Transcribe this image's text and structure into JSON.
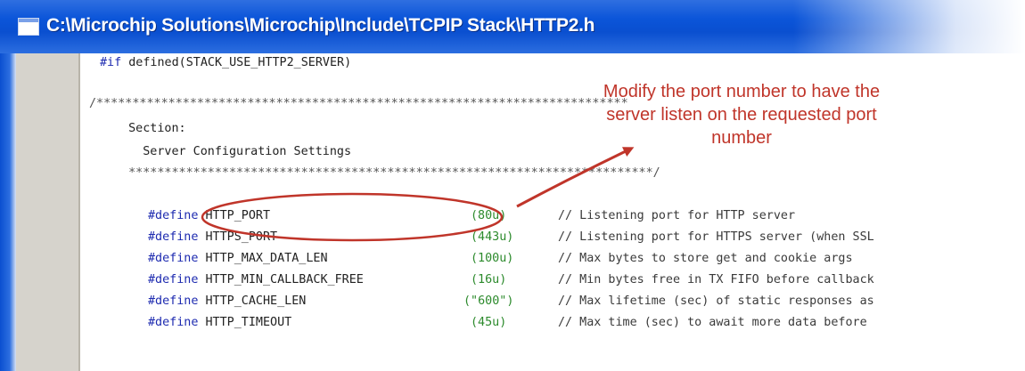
{
  "window": {
    "title": "C:\\Microchip Solutions\\Microchip\\Include\\TCPIP Stack\\HTTP2.h"
  },
  "code": {
    "ifdef": {
      "keyword": "#if",
      "rest": " defined(STACK_USE_HTTP2_SERVER)"
    },
    "stars_top": "/**************************************************************************",
    "section_label": "  Section:",
    "section_title": "    Server Configuration Settings",
    "stars_bottom": "  *************************************************************************/",
    "defines": [
      {
        "keyword": "#define",
        "name": "HTTP_PORT",
        "value": "(80u)",
        "comment": "// Listening port for HTTP server"
      },
      {
        "keyword": "#define",
        "name": "HTTPS_PORT",
        "value": "(443u)",
        "comment": "// Listening port for HTTPS server (when SSL"
      },
      {
        "keyword": "#define",
        "name": "HTTP_MAX_DATA_LEN",
        "value": "(100u)",
        "comment": "// Max bytes to store get and cookie args"
      },
      {
        "keyword": "#define",
        "name": "HTTP_MIN_CALLBACK_FREE",
        "value": "(16u)",
        "comment": "// Min bytes free in TX FIFO before callback"
      },
      {
        "keyword": "#define",
        "name": "HTTP_CACHE_LEN",
        "value": "(\"600\")",
        "comment": "// Max lifetime (sec) of static responses as"
      },
      {
        "keyword": "#define",
        "name": "HTTP_TIMEOUT",
        "value": "(45u)",
        "comment": "// Max time (sec) to await more data before"
      }
    ]
  },
  "annotation": {
    "text_line1": "Modify the port number to have the",
    "text_line2": "server listen on the requested port",
    "text_line3": "number",
    "color": "#c0352a"
  }
}
